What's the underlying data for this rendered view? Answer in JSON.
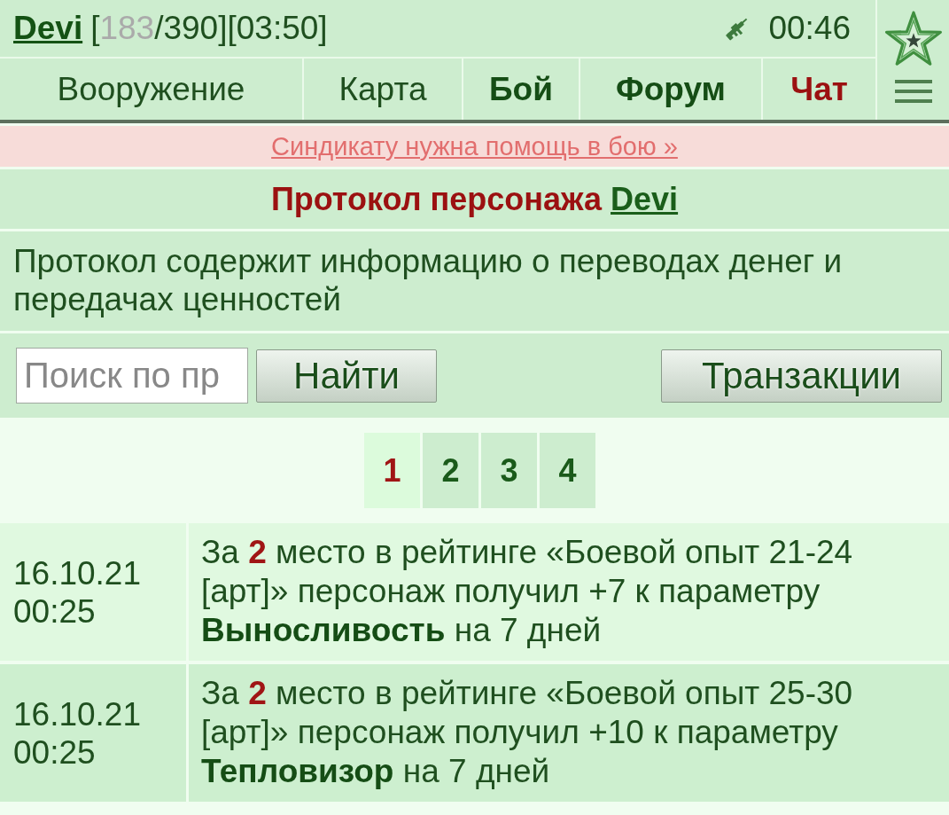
{
  "header": {
    "player": {
      "name": "Devi",
      "status": [
        {
          "text": "[",
          "kind": "plain"
        },
        {
          "text": "183",
          "kind": "dim"
        },
        {
          "text": "/390][03:50]",
          "kind": "plain"
        }
      ]
    },
    "clock": "00:46"
  },
  "nav": [
    {
      "label": "Вооружение",
      "kind": "plain"
    },
    {
      "label": "Карта",
      "kind": "plain"
    },
    {
      "label": "Бой",
      "kind": "bold"
    },
    {
      "label": "Форум",
      "kind": "bold"
    },
    {
      "label": "Чат",
      "kind": "alert"
    }
  ],
  "banner": {
    "link": "Синдикату нужна помощь в бою »"
  },
  "title": {
    "text": "Протокол персонажа",
    "player": "Devi"
  },
  "description": "Протокол содержит информацию о переводах денег и передачах ценностей",
  "search": {
    "placeholder": "Поиск по пр",
    "button": "Найти",
    "transactions_button": "Транзакции"
  },
  "pagination": [
    {
      "label": "1",
      "selected": true
    },
    {
      "label": "2",
      "selected": false
    },
    {
      "label": "3",
      "selected": false
    },
    {
      "label": "4",
      "selected": false
    }
  ],
  "log": [
    {
      "date": "16.10.21",
      "time": "00:25",
      "message": [
        {
          "text": "За ",
          "kind": "plain"
        },
        {
          "text": "2",
          "kind": "rank"
        },
        {
          "text": " место в рейтинге «Боевой опыт 21-24 [арт]» персонаж получил +7 к параметру ",
          "kind": "plain"
        },
        {
          "text": "Выносливость",
          "kind": "param"
        },
        {
          "text": " на 7 дней",
          "kind": "plain"
        }
      ]
    },
    {
      "date": "16.10.21",
      "time": "00:25",
      "message": [
        {
          "text": "За ",
          "kind": "plain"
        },
        {
          "text": "2",
          "kind": "rank"
        },
        {
          "text": " место в рейтинге «Боевой опыт 25-30 [арт]» персонаж получил +10 к параметру ",
          "kind": "plain"
        },
        {
          "text": "Тепловизор",
          "kind": "param"
        },
        {
          "text": " на 7 дней",
          "kind": "plain"
        }
      ]
    }
  ]
}
